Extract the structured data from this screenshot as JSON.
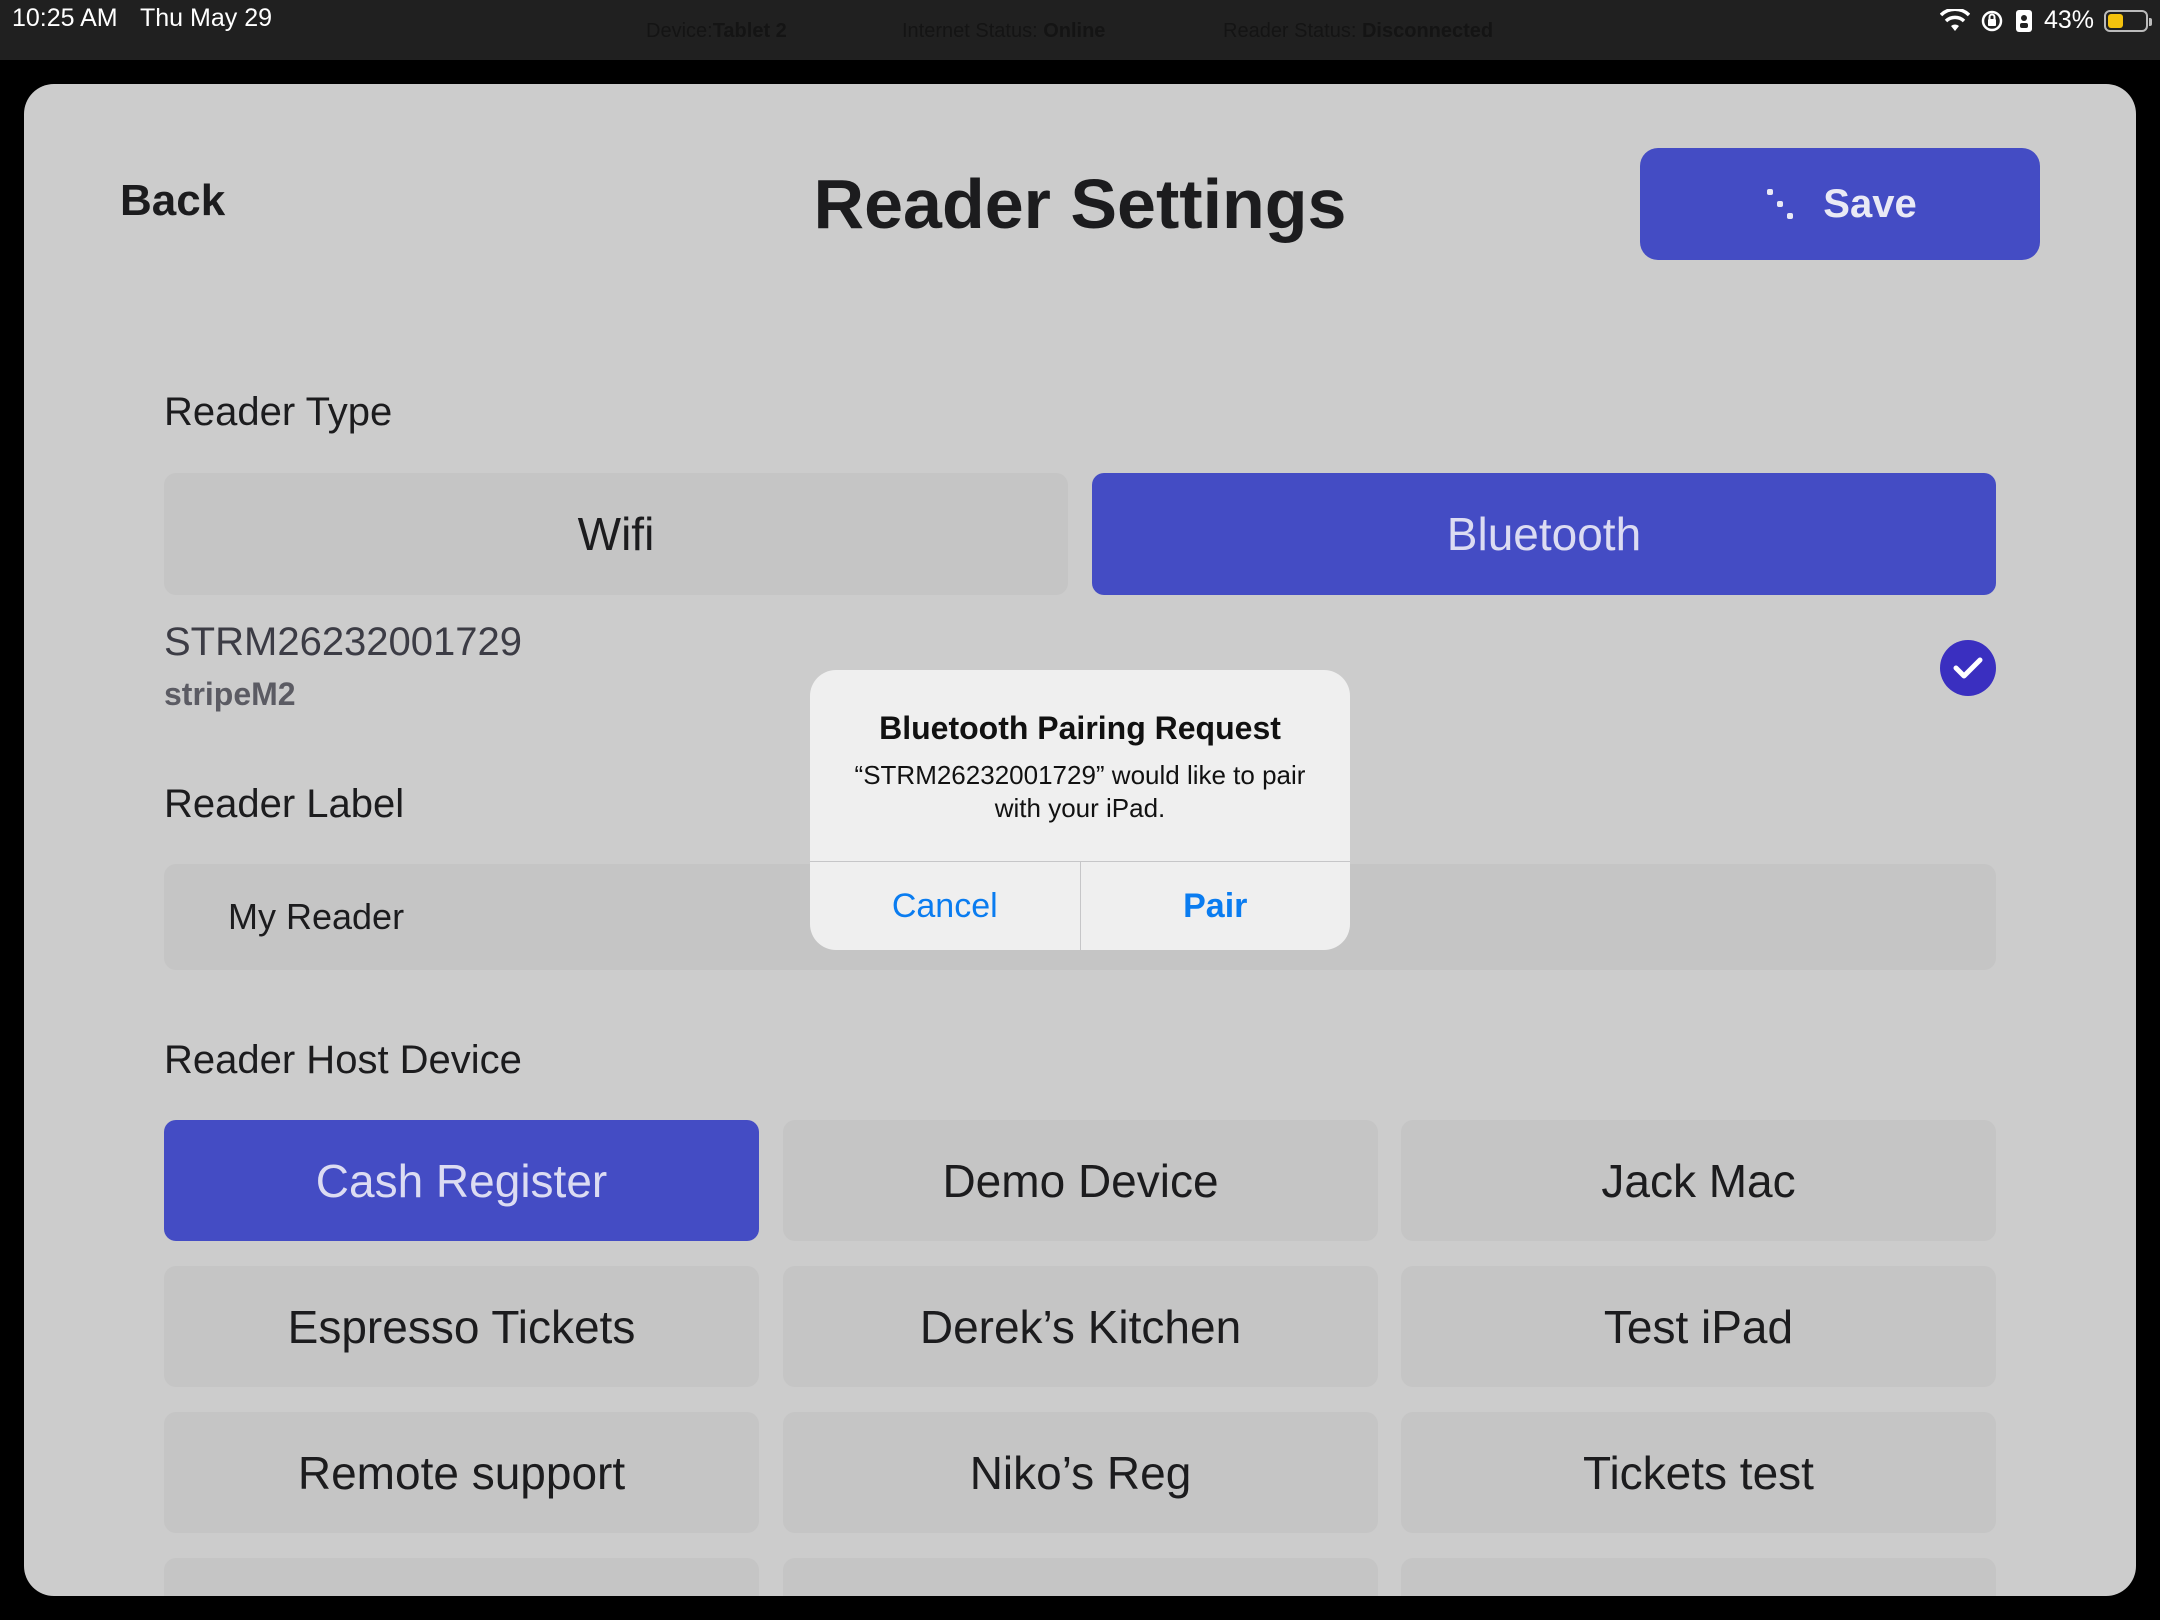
{
  "status_bar": {
    "time": "10:25 AM",
    "date": "Thu May 29",
    "device_label": "Device:",
    "device_value": "Tablet 2",
    "internet_label": "Internet Status:",
    "internet_value": "Online",
    "reader_label": "Reader Status:",
    "reader_value": "Disconnected",
    "battery": "43%",
    "battery_level": 0.43
  },
  "header": {
    "back": "Back",
    "title": "Reader Settings",
    "save": "Save"
  },
  "reader_type": {
    "label": "Reader Type",
    "options": [
      "Wifi",
      "Bluetooth"
    ],
    "selected": "Bluetooth"
  },
  "reader": {
    "serial": "STRM26232001729",
    "model": "stripeM2"
  },
  "reader_label": {
    "label": "Reader Label",
    "value": "My Reader"
  },
  "host_device": {
    "label": "Reader Host Device",
    "options": [
      "Cash Register",
      "Demo Device",
      "Jack Mac",
      "Espresso Tickets",
      "Derek’s Kitchen",
      "Test iPad",
      "Remote support",
      "Niko’s Reg",
      "Tickets test"
    ],
    "selected": "Cash Register"
  },
  "alert": {
    "title": "Bluetooth Pairing Request",
    "message": "“STRM26232001729” would like to pair with your iPad.",
    "cancel": "Cancel",
    "confirm": "Pair"
  },
  "colors": {
    "accent": "#444cc4",
    "link": "#0a7cf0",
    "sheet": "#cccccc"
  }
}
